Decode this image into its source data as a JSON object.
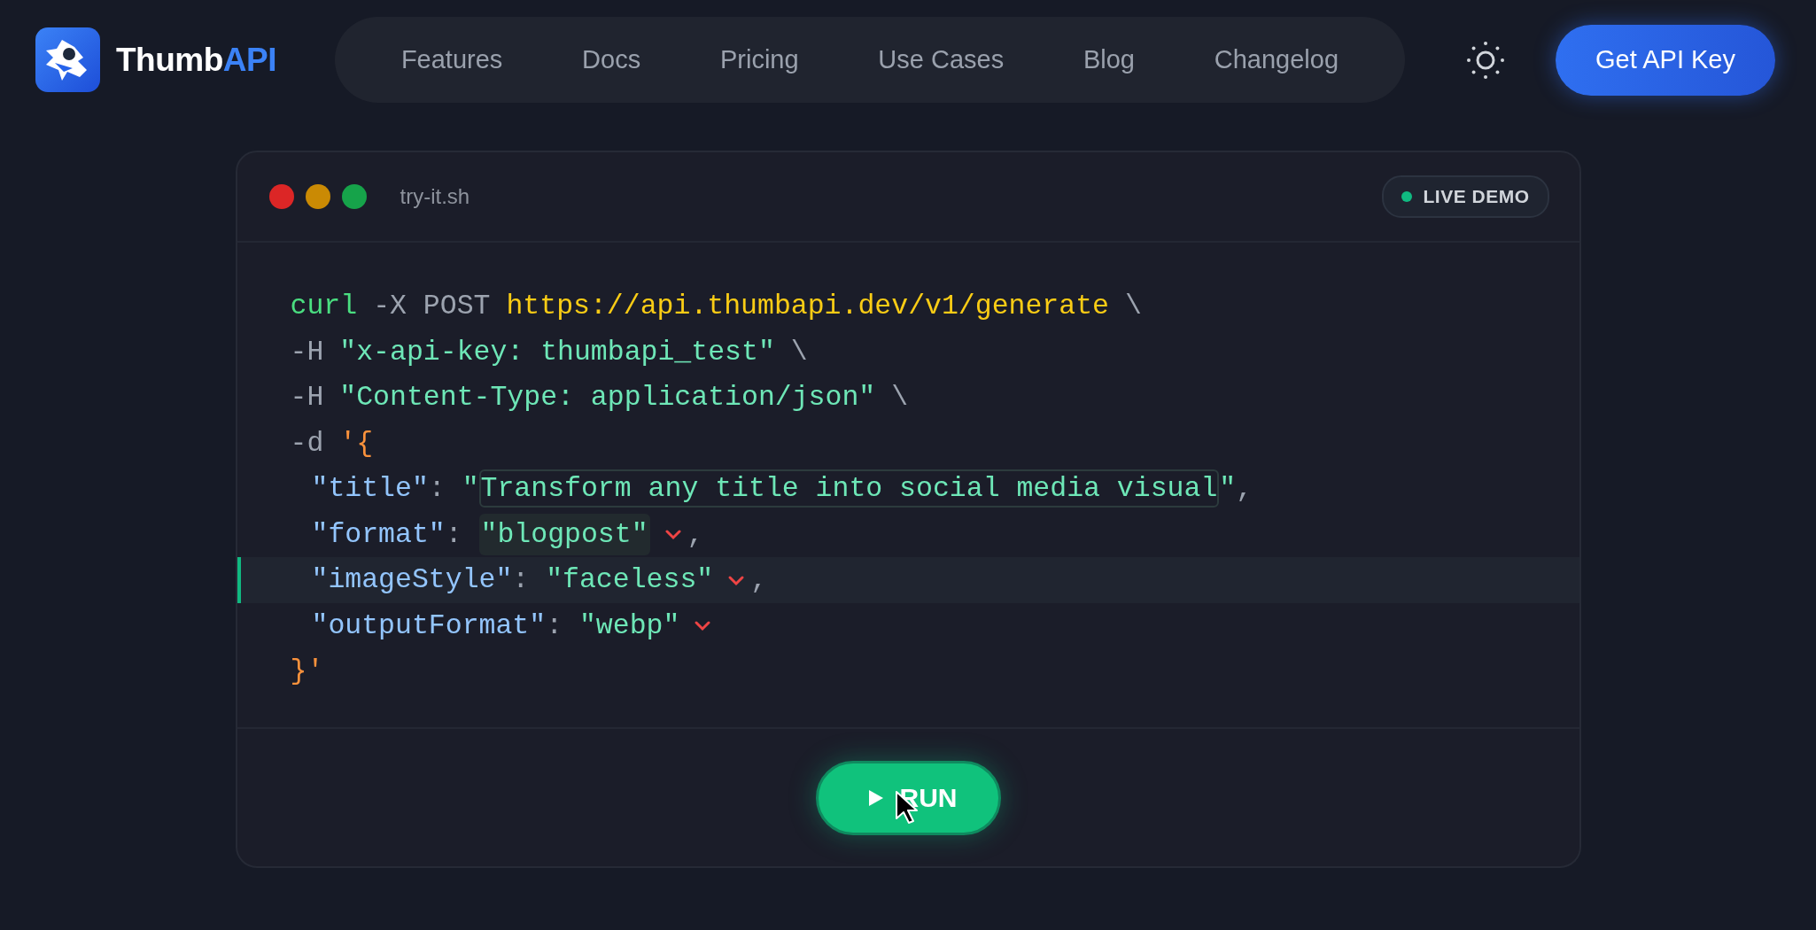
{
  "header": {
    "logo": {
      "name": "Thumb",
      "accent": "API"
    },
    "nav": [
      {
        "label": "Features"
      },
      {
        "label": "Docs"
      },
      {
        "label": "Pricing"
      },
      {
        "label": "Use Cases"
      },
      {
        "label": "Blog"
      },
      {
        "label": "Changelog"
      }
    ],
    "cta": "Get API Key"
  },
  "terminal": {
    "filename": "try-it.sh",
    "badge": "LIVE DEMO",
    "lines": [
      {
        "kind": "shell",
        "active": false,
        "tokens": [
          {
            "kind": "command",
            "text": "curl"
          },
          {
            "kind": "flag",
            "text": "-X POST"
          },
          {
            "kind": "url",
            "text": "https://api.thumbapi.dev/v1/generate"
          },
          {
            "kind": "flag",
            "text": "\\"
          }
        ]
      },
      {
        "kind": "shell",
        "active": false,
        "tokens": [
          {
            "kind": "flag",
            "text": "-H"
          },
          {
            "kind": "string",
            "text": "\"x-api-key: thumbapi_test\""
          },
          {
            "kind": "flag",
            "text": "\\"
          }
        ]
      },
      {
        "kind": "shell",
        "active": false,
        "tokens": [
          {
            "kind": "flag",
            "text": "-H"
          },
          {
            "kind": "string",
            "text": "\"Content-Type: application/json\""
          },
          {
            "kind": "flag",
            "text": "\\"
          }
        ]
      },
      {
        "kind": "shell",
        "active": false,
        "tokens": [
          {
            "kind": "flag",
            "text": "-d"
          },
          {
            "kind": "brace",
            "text": "'{"
          }
        ]
      },
      {
        "kind": "param",
        "active": false,
        "tokens": [
          {
            "kind": "key",
            "text": "\"title\""
          },
          {
            "kind": "punct",
            "text": ": "
          },
          {
            "kind": "string",
            "text": "\""
          },
          {
            "kind": "field",
            "text": "Transform any title into social media visual"
          },
          {
            "kind": "string",
            "text": "\""
          },
          {
            "kind": "punct",
            "text": ","
          }
        ]
      },
      {
        "kind": "param",
        "active": false,
        "tokens": [
          {
            "kind": "key",
            "text": "\"format\""
          },
          {
            "kind": "punct",
            "text": ": "
          },
          {
            "kind": "chip",
            "text": "\"blogpost\""
          },
          {
            "kind": "chevron"
          },
          {
            "kind": "punct",
            "text": ","
          }
        ]
      },
      {
        "kind": "param",
        "active": true,
        "tokens": [
          {
            "kind": "key",
            "text": "\"imageStyle\""
          },
          {
            "kind": "punct",
            "text": ": "
          },
          {
            "kind": "string",
            "text": "\"faceless\""
          },
          {
            "kind": "chevron"
          },
          {
            "kind": "punct",
            "text": ","
          }
        ]
      },
      {
        "kind": "param",
        "active": false,
        "tokens": [
          {
            "kind": "key",
            "text": "\"outputFormat\""
          },
          {
            "kind": "punct",
            "text": ": "
          },
          {
            "kind": "string",
            "text": "\"webp\""
          },
          {
            "kind": "chevron"
          }
        ]
      },
      {
        "kind": "shell",
        "active": false,
        "tokens": [
          {
            "kind": "brace",
            "text": "}'"
          }
        ]
      }
    ],
    "run": "RUN"
  }
}
